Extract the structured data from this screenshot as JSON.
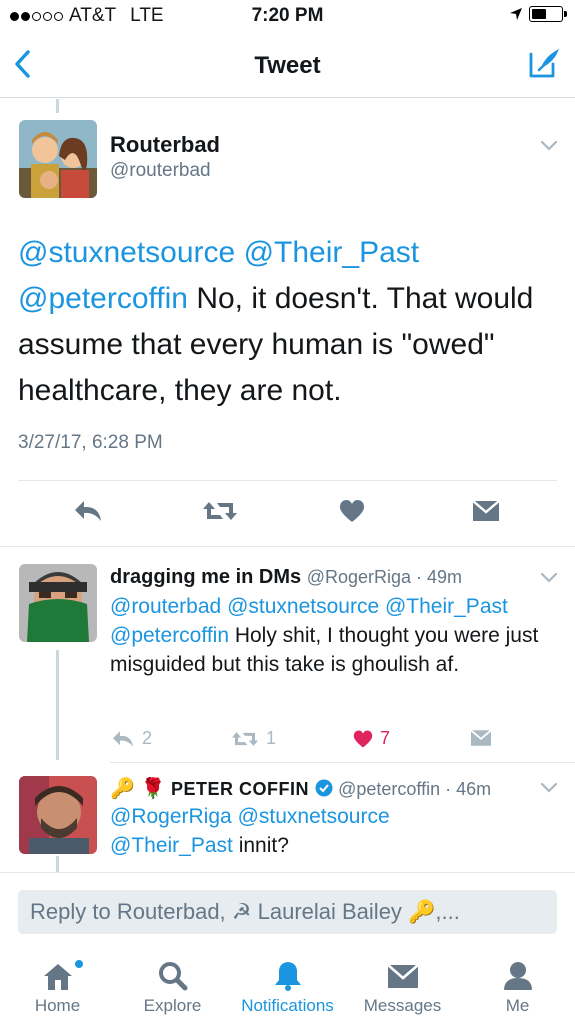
{
  "status_bar": {
    "carrier": "AT&T",
    "network": "LTE",
    "time": "7:20 PM",
    "battery_level": 0.55
  },
  "nav": {
    "title": "Tweet"
  },
  "main_tweet": {
    "name": "Routerbad",
    "handle": "@routerbad",
    "mention_1": "@stuxnetsource",
    "mention_2": "@Their_Past",
    "mention_3": "@petercoffin",
    "text_line_1_rest": " No, it doesn't. That would",
    "text_rest": "assume that every human is \"owed\" healthcare, they are not.",
    "timestamp": "3/27/17, 6:28 PM"
  },
  "replies": [
    {
      "name": "dragging me in DMs",
      "handle": "@RogerRiga",
      "age": "49m",
      "mention_1": "@routerbad",
      "mention_2": "@stuxnetsource",
      "mention_3": "@Their_Past",
      "mention_4": "@petercoffin",
      "text": " Holy shit, I thought you were just misguided but this take is ghoulish af.",
      "reply_count": "2",
      "retweet_count": "1",
      "like_count": "7",
      "like_color": "#e0245e"
    },
    {
      "name": "PETER COFFIN",
      "handle": "@petercoffin",
      "age": "46m",
      "mention_1": "@RogerRiga",
      "mention_2": "@stuxnetsource",
      "mention_3": "@Their_Past",
      "text": " innit?"
    }
  ],
  "reply_box": {
    "placeholder": "Reply to Routerbad, ☭ Laurelai Bailey 🔑,..."
  },
  "tabs": [
    {
      "label": "Home",
      "icon": "home-icon"
    },
    {
      "label": "Explore",
      "icon": "search-icon"
    },
    {
      "label": "Notifications",
      "icon": "bell-icon"
    },
    {
      "label": "Messages",
      "icon": "envelope-icon"
    },
    {
      "label": "Me",
      "icon": "person-icon"
    }
  ],
  "colors": {
    "accent": "#1b95e0",
    "muted": "#657786",
    "icon_gray": "#aab8c2",
    "like": "#e0245e"
  }
}
